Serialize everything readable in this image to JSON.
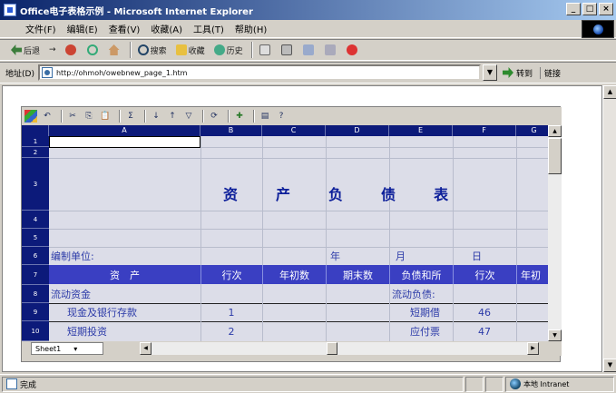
{
  "window": {
    "title": "Office电子表格示例 - Microsoft Internet Explorer",
    "btn_min": "_",
    "btn_max": "□",
    "btn_close": "×"
  },
  "menu": [
    "文件(F)",
    "编辑(E)",
    "查看(V)",
    "收藏(A)",
    "工具(T)",
    "帮助(H)"
  ],
  "toolbar": {
    "back": "后退",
    "forward": "→",
    "search": "搜索",
    "favorites": "收藏",
    "history": "历史"
  },
  "address": {
    "label": "地址(D)",
    "url": "http://ohmoh/owebnew_page_1.htm",
    "go": "转到",
    "links": "链接"
  },
  "status": {
    "left": "完成",
    "zone": "本地 Intranet"
  },
  "sheet": {
    "columns": [
      "A",
      "B",
      "C",
      "D",
      "E",
      "F",
      "G"
    ],
    "rows": [
      "1",
      "2",
      "3",
      "4",
      "5",
      "6",
      "7",
      "8",
      "9",
      "10"
    ],
    "title_chars": [
      "资",
      "产",
      "负",
      "债",
      "表"
    ],
    "row6": {
      "a": "编制单位:",
      "d": "年",
      "e": "月",
      "f": "日"
    },
    "header": [
      "资　产",
      "行次",
      "年初数",
      "期末数",
      "负债和所",
      "行次",
      "年初"
    ],
    "row8": {
      "a": "流动资金",
      "e": "流动负债:"
    },
    "row9": {
      "a": "现金及银行存款",
      "b": "1",
      "e": "短期借",
      "f": "46"
    },
    "row10": {
      "a": "短期投资",
      "b": "2",
      "e": "应付票",
      "f": "47"
    },
    "tab": "Sheet1",
    "tab_arrow": "▾"
  }
}
